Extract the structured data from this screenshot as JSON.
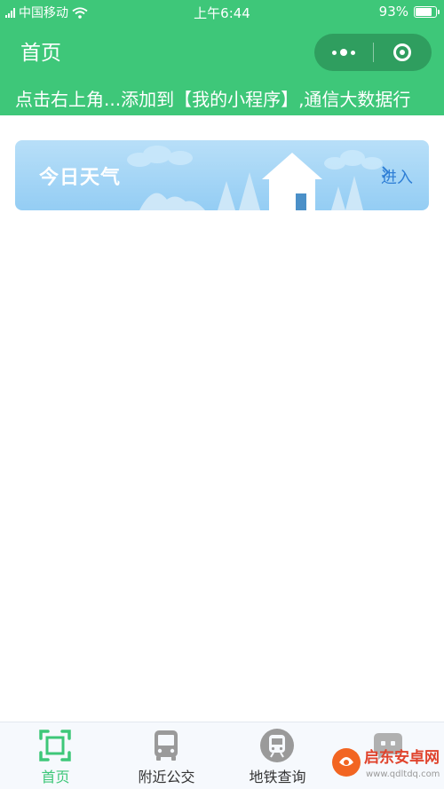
{
  "status_bar": {
    "carrier": "中国移动",
    "time": "上午6:44",
    "battery": "93%",
    "battery_level": 0.93,
    "icons": [
      "signal-icon",
      "wifi-icon",
      "battery-icon"
    ]
  },
  "nav": {
    "title": "首页",
    "icons": [
      "more-dots-icon",
      "close-target-icon"
    ]
  },
  "marquee": {
    "text": "点击右上角...添加到【我的小程序】,通信大数据行"
  },
  "weather_card": {
    "title": "今日天气",
    "enter_label": "进入",
    "icon": "chevron-right-icon"
  },
  "tabbar": {
    "tabs": [
      {
        "label": "首页",
        "icon": "scan-frame-icon",
        "active": true
      },
      {
        "label": "附近公交",
        "icon": "bus-icon",
        "active": false
      },
      {
        "label": "地铁查询",
        "icon": "subway-icon",
        "active": false
      },
      {
        "label": "",
        "icon": "chat-icon",
        "active": false
      }
    ]
  },
  "watermark": {
    "brand": "启东安卓网",
    "url": "www.qdltdq.com"
  },
  "colors": {
    "primary": "#3ec779",
    "capsule": "#2f9e5f",
    "card_sky": "#a8d7f6",
    "enter_link": "#2f7fd6",
    "tabbar_bg": "#f6f9fd"
  }
}
